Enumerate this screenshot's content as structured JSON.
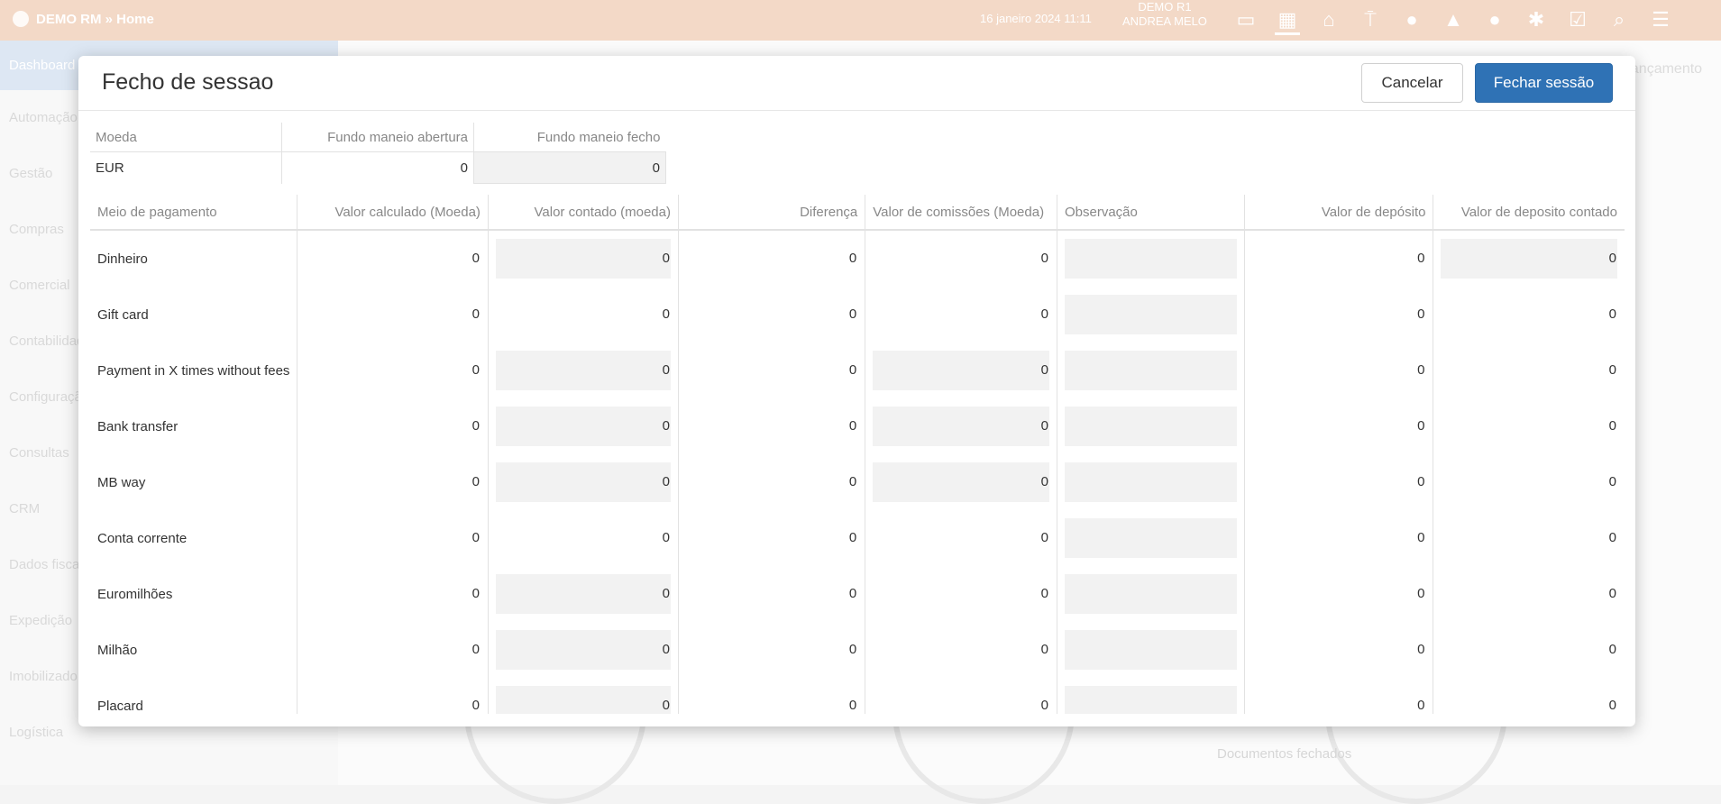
{
  "app": {
    "title": "DEMO RM » Home",
    "datetime": "16 janeiro 2024 11:11",
    "user_line1": "DEMO R1",
    "user_line2": "ANDREA MELO"
  },
  "top_icons": [
    "display-icon",
    "calendar-icon",
    "home-icon",
    "pin-icon",
    "chat-icon",
    "bell-icon",
    "user-icon",
    "bug-icon",
    "checkbox-icon",
    "search-icon",
    "menu-icon"
  ],
  "sidebar": {
    "head": "Dashboard",
    "items": [
      "Automação",
      "Gestão",
      "Compras",
      "Comercial",
      "Contabilidade",
      "Configuração",
      "Consultas",
      "CRM",
      "Dados fiscais",
      "Expedição",
      "Imobilizado",
      "Logística"
    ]
  },
  "background": {
    "right_label": "Lançamento",
    "footer_text": "Documentos fechados"
  },
  "modal": {
    "title": "Fecho de sessao",
    "cancel_label": "Cancelar",
    "close_label": "Fechar sessão"
  },
  "currency_table": {
    "headers": [
      "Moeda",
      "Fundo maneio abertura",
      "Fundo maneio fecho"
    ],
    "row": {
      "currency": "EUR",
      "opening": "0",
      "closing": "0"
    }
  },
  "payment_table": {
    "headers": [
      "Meio de pagamento",
      "Valor calculado (Moeda)",
      "Valor contado (moeda)",
      "Diferença",
      "Valor de comissões (Moeda)",
      "Observação",
      "Valor de depósito",
      "Valor de deposito contado"
    ],
    "rows": [
      {
        "method": "Dinheiro",
        "calculated": "0",
        "counted": "0",
        "difference": "0",
        "commissions": "0",
        "deposit": "0",
        "deposit_counted": "0"
      },
      {
        "method": "Gift card",
        "calculated": "0",
        "counted": "0",
        "difference": "0",
        "commissions": "0",
        "deposit": "0",
        "deposit_counted": "0"
      },
      {
        "method": "Payment in X times without fees",
        "calculated": "0",
        "counted": "0",
        "difference": "0",
        "commissions": "0",
        "deposit": "0",
        "deposit_counted": "0"
      },
      {
        "method": "Bank transfer",
        "calculated": "0",
        "counted": "0",
        "difference": "0",
        "commissions": "0",
        "deposit": "0",
        "deposit_counted": "0"
      },
      {
        "method": "MB way",
        "calculated": "0",
        "counted": "0",
        "difference": "0",
        "commissions": "0",
        "deposit": "0",
        "deposit_counted": "0"
      },
      {
        "method": "Conta corrente",
        "calculated": "0",
        "counted": "0",
        "difference": "0",
        "commissions": "0",
        "deposit": "0",
        "deposit_counted": "0"
      },
      {
        "method": "Euromilhões",
        "calculated": "0",
        "counted": "0",
        "difference": "0",
        "commissions": "0",
        "deposit": "0",
        "deposit_counted": "0"
      },
      {
        "method": "Milhão",
        "calculated": "0",
        "counted": "0",
        "difference": "0",
        "commissions": "0",
        "deposit": "0",
        "deposit_counted": "0"
      },
      {
        "method": "Placard",
        "calculated": "0",
        "counted": "0",
        "difference": "0",
        "commissions": "0",
        "deposit": "0",
        "deposit_counted": "0"
      }
    ]
  }
}
